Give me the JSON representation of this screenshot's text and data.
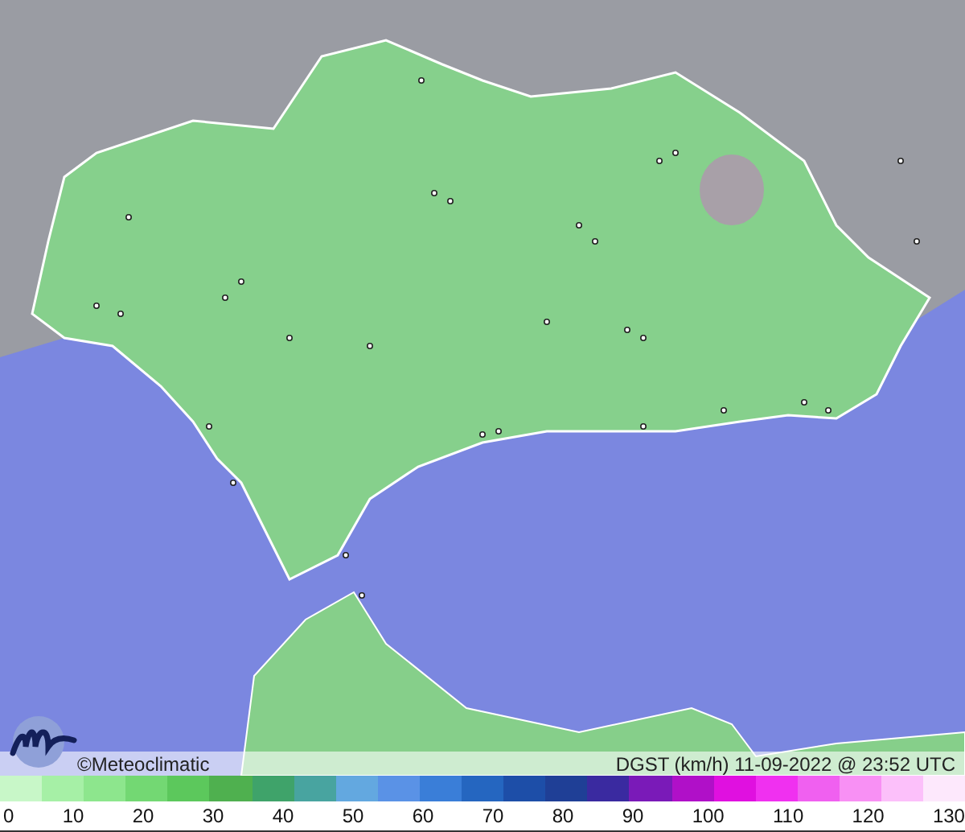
{
  "map": {
    "credit": "©Meteoclimatic",
    "caption": "DGST (km/h)  11-09-2022 @ 23:52 UTC"
  },
  "scale": {
    "labels": [
      "0",
      "10",
      "20",
      "30",
      "40",
      "50",
      "60",
      "70",
      "80",
      "90",
      "100",
      "110",
      "120",
      "130"
    ]
  }
}
